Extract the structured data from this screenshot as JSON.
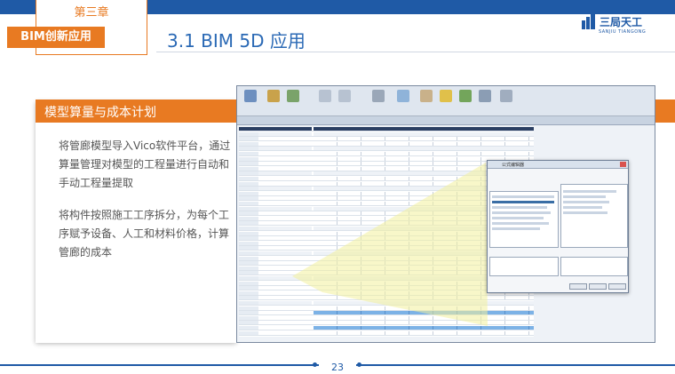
{
  "header": {
    "chapter": "第三章",
    "section_badge": "BIM创新应用",
    "title": "3.1 BIM 5D 应用",
    "brand_color": "#1f5aa6",
    "accent_color": "#e87a22"
  },
  "logo": {
    "icon": "building-logo-icon",
    "text": "三局天工",
    "subtext": "SANJIU TIANGONG"
  },
  "content": {
    "heading": "模型算量与成本计划",
    "paragraphs": [
      "将管廊模型导入Vico软件平台，通过算量管理对模型的工程量进行自动和手动工程量提取",
      "将构件按照施工工序拆分，为每个工序赋予设备、人工和材料价格，计算管廊的成本"
    ]
  },
  "screenshot": {
    "icon": "vico-software-screenshot",
    "dialog_title": "公式编辑器"
  },
  "footer": {
    "page_number": "23"
  }
}
